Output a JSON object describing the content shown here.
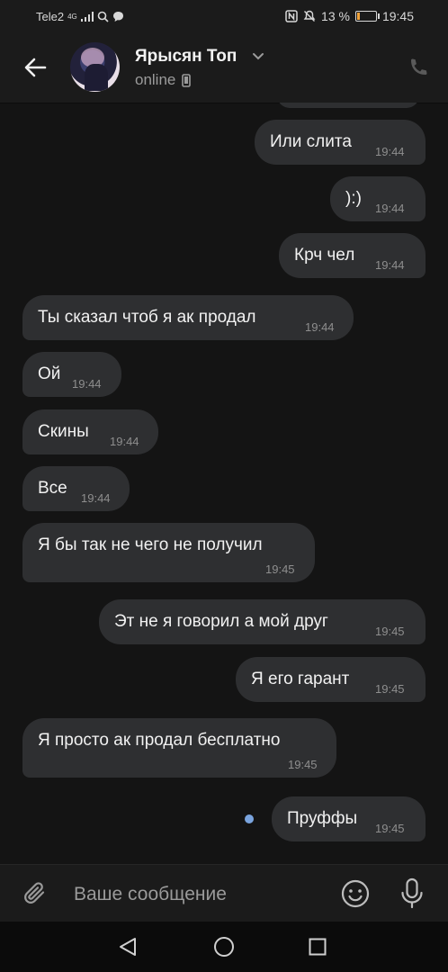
{
  "status_bar": {
    "carrier": "Tele2",
    "network": "4G",
    "battery_percent": "13 %",
    "battery_level": 0.13,
    "time": "19:45",
    "battery_color": "#f2a33a"
  },
  "header": {
    "contact_name": "Ярысян Топ",
    "status": "online"
  },
  "messages": [
    {
      "text": "Или слита",
      "time": "19:44",
      "direction": "out"
    },
    {
      "text": "):)",
      "time": "19:44",
      "direction": "out"
    },
    {
      "text": "Крч чел",
      "time": "19:44",
      "direction": "out"
    },
    {
      "text": "Ты сказал чтоб я ак продал",
      "time": "19:44",
      "direction": "in"
    },
    {
      "text": "Ой",
      "time": "19:44",
      "direction": "in"
    },
    {
      "text": "Скины",
      "time": "19:44",
      "direction": "in"
    },
    {
      "text": "Все",
      "time": "19:44",
      "direction": "in"
    },
    {
      "text": "Я бы так не чего не получил",
      "time": "19:45",
      "direction": "in"
    },
    {
      "text": "Эт не я говорил а мой друг",
      "time": "19:45",
      "direction": "out"
    },
    {
      "text": "Я его гарант",
      "time": "19:45",
      "direction": "out"
    },
    {
      "text": "Я просто ак продал бесплатно",
      "time": "19:45",
      "direction": "in"
    },
    {
      "text": "Пруффы",
      "time": "19:45",
      "direction": "out",
      "unread": true
    }
  ],
  "composer": {
    "placeholder": "Ваше сообщение"
  },
  "colors": {
    "background": "#141414",
    "bubble": "#2e2f31",
    "unread_dot": "#7aa4de"
  }
}
